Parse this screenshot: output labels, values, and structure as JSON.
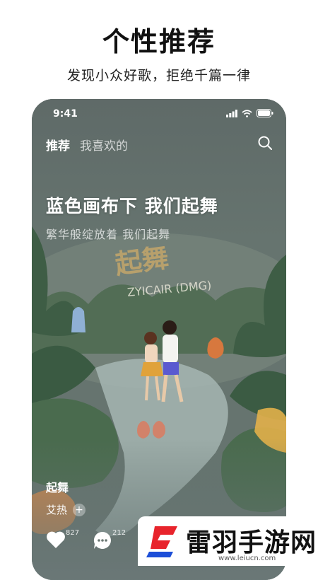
{
  "promo": {
    "title": "个性推荐",
    "subtitle": "发现小众好歌，拒绝千篇一律"
  },
  "status_bar": {
    "time": "9:41",
    "icons": [
      "signal-icon",
      "wifi-icon",
      "battery-icon"
    ]
  },
  "tabs": [
    {
      "label": "推荐",
      "active": true
    },
    {
      "label": "我喜欢的",
      "active": false
    }
  ],
  "search": {
    "icon": "search-icon"
  },
  "song": {
    "headline": "蓝色画布下 我们起舞",
    "lyric": "繁华般绽放着 我们起舞",
    "name": "起舞",
    "artist": "艾热",
    "follow_symbol": "+"
  },
  "cover_art": {
    "logo_text": "起舞",
    "brand_text": "ZYICAIR (DMG)"
  },
  "actions": {
    "like": {
      "icon": "heart-icon",
      "count": "827"
    },
    "comment": {
      "icon": "comment-icon",
      "count": "212"
    }
  },
  "watermark": {
    "text": "雷羽手游网",
    "url": "www.leiucn.com"
  },
  "colors": {
    "accent_red": "#e8242c",
    "accent_blue": "#1d4fd8"
  }
}
